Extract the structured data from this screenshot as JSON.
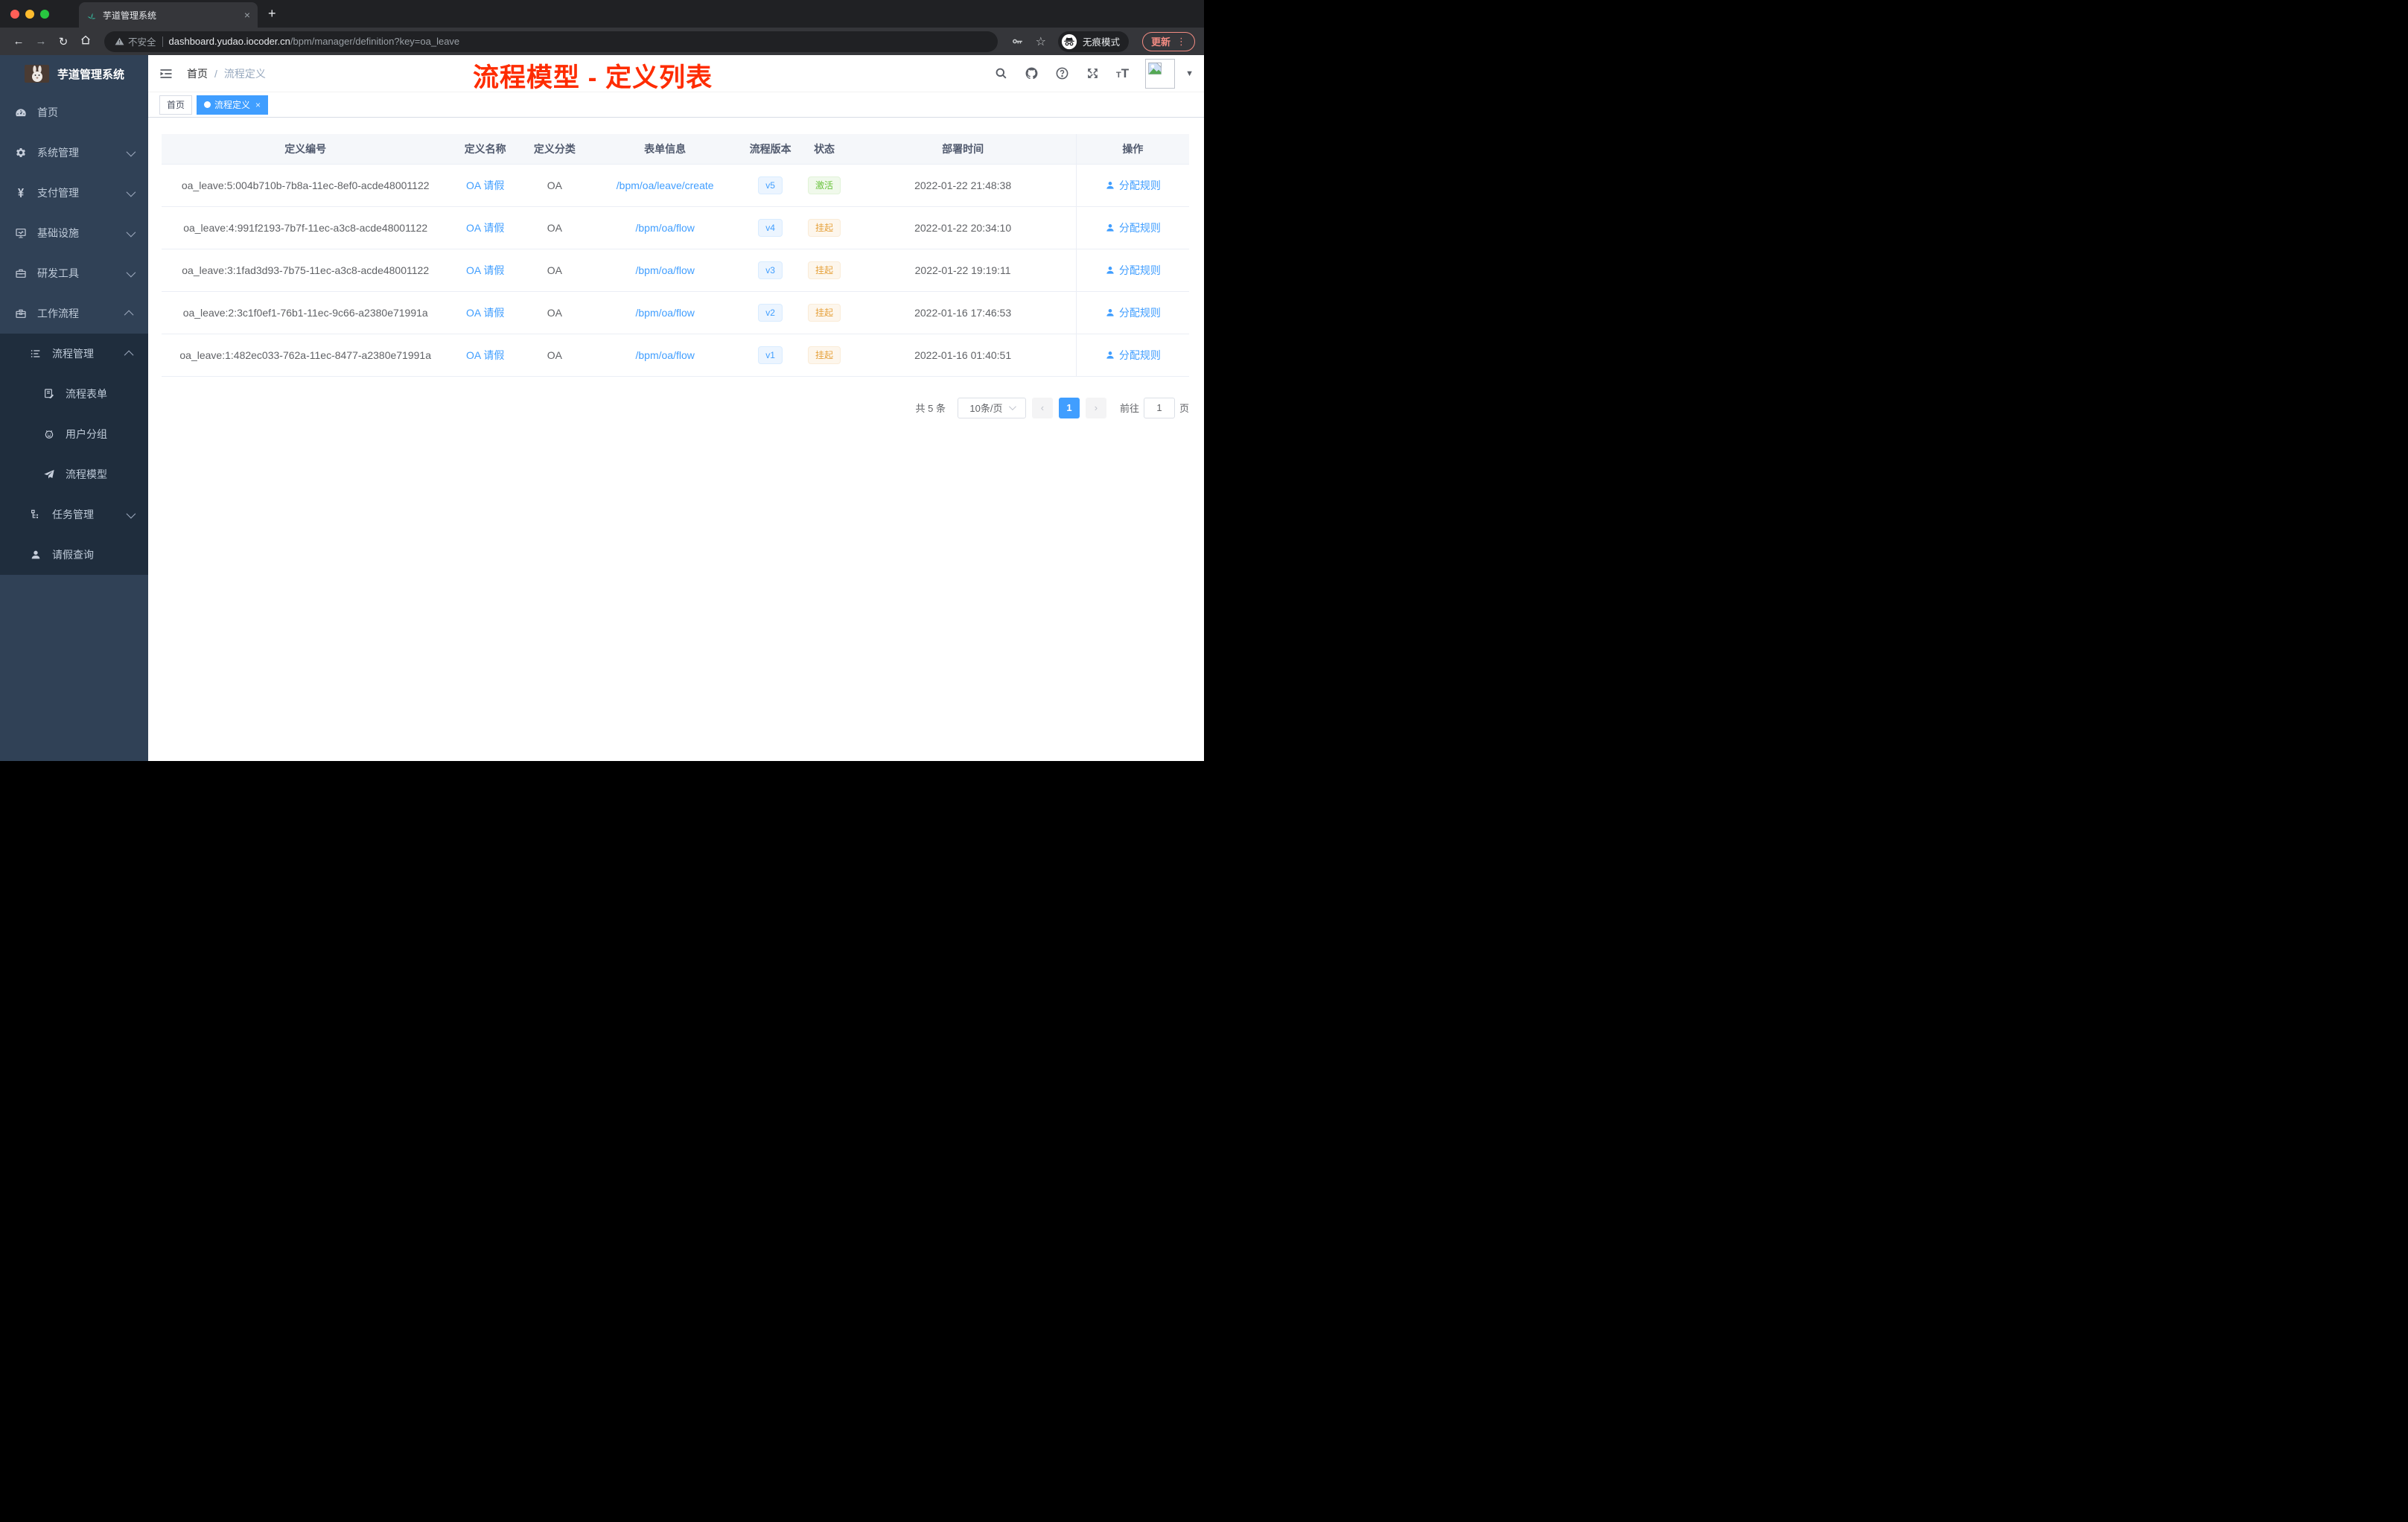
{
  "browser": {
    "tab": {
      "title": "芋道管理系统",
      "close": "×",
      "new_tab": "+"
    },
    "nav": {
      "back": "←",
      "forward": "→",
      "reload": "↻"
    },
    "url": {
      "security_label": "不安全",
      "host": "dashboard.yudao.iocoder.cn",
      "path": "/bpm/manager/definition?key=oa_leave"
    },
    "incognito_label": "无痕模式",
    "update_label": "更新"
  },
  "sidebar": {
    "title": "芋道管理系统",
    "items": [
      {
        "id": "home",
        "label": "首页",
        "icon": "gauge-icon",
        "level": 1,
        "arrow": null,
        "nested": false
      },
      {
        "id": "system",
        "label": "系统管理",
        "icon": "gear-icon",
        "level": 1,
        "arrow": "down",
        "nested": false
      },
      {
        "id": "payment",
        "label": "支付管理",
        "icon": "yen-icon",
        "level": 1,
        "arrow": "down",
        "nested": false
      },
      {
        "id": "infra",
        "label": "基础设施",
        "icon": "monitor-icon",
        "level": 1,
        "arrow": "down",
        "nested": false
      },
      {
        "id": "devtools",
        "label": "研发工具",
        "icon": "toolbox-icon",
        "level": 1,
        "arrow": "down",
        "nested": false
      },
      {
        "id": "workflow",
        "label": "工作流程",
        "icon": "briefcase-icon",
        "level": 1,
        "arrow": "up",
        "nested": false
      },
      {
        "id": "process-mgmt",
        "label": "流程管理",
        "icon": "list-icon",
        "level": 2,
        "arrow": "up",
        "nested": true
      },
      {
        "id": "process-form",
        "label": "流程表单",
        "icon": "form-icon",
        "level": 3,
        "arrow": null,
        "nested": true
      },
      {
        "id": "user-group",
        "label": "用户分组",
        "icon": "robot-icon",
        "level": 3,
        "arrow": null,
        "nested": true
      },
      {
        "id": "process-model",
        "label": "流程模型",
        "icon": "paper-plane-icon",
        "level": 3,
        "arrow": null,
        "nested": true
      },
      {
        "id": "task-mgmt",
        "label": "任务管理",
        "icon": "tree-icon",
        "level": 2,
        "arrow": "down",
        "nested": true
      },
      {
        "id": "leave-query",
        "label": "请假查询",
        "icon": "person-icon",
        "level": 2,
        "arrow": null,
        "nested": true
      }
    ]
  },
  "header": {
    "breadcrumb": {
      "home": "首页",
      "separator": "/",
      "current": "流程定义"
    },
    "annotation": "流程模型 - 定义列表"
  },
  "tags": {
    "home": "首页",
    "active": "流程定义",
    "close": "×"
  },
  "table": {
    "columns": [
      "定义编号",
      "定义名称",
      "定义分类",
      "表单信息",
      "流程版本",
      "状态",
      "部署时间",
      "操作"
    ],
    "action_label": "分配规则",
    "rows": [
      {
        "id": "oa_leave:5:004b710b-7b8a-11ec-8ef0-acde48001122",
        "name": "OA 请假",
        "category": "OA",
        "form": "/bpm/oa/leave/create",
        "version": "v5",
        "status": {
          "label": "激活",
          "type": "success"
        },
        "deploy_time": "2022-01-22 21:48:38"
      },
      {
        "id": "oa_leave:4:991f2193-7b7f-11ec-a3c8-acde48001122",
        "name": "OA 请假",
        "category": "OA",
        "form": "/bpm/oa/flow",
        "version": "v4",
        "status": {
          "label": "挂起",
          "type": "warning"
        },
        "deploy_time": "2022-01-22 20:34:10"
      },
      {
        "id": "oa_leave:3:1fad3d93-7b75-11ec-a3c8-acde48001122",
        "name": "OA 请假",
        "category": "OA",
        "form": "/bpm/oa/flow",
        "version": "v3",
        "status": {
          "label": "挂起",
          "type": "warning"
        },
        "deploy_time": "2022-01-22 19:19:11"
      },
      {
        "id": "oa_leave:2:3c1f0ef1-76b1-11ec-9c66-a2380e71991a",
        "name": "OA 请假",
        "category": "OA",
        "form": "/bpm/oa/flow",
        "version": "v2",
        "status": {
          "label": "挂起",
          "type": "warning"
        },
        "deploy_time": "2022-01-16 17:46:53"
      },
      {
        "id": "oa_leave:1:482ec033-762a-11ec-8477-a2380e71991a",
        "name": "OA 请假",
        "category": "OA",
        "form": "/bpm/oa/flow",
        "version": "v1",
        "status": {
          "label": "挂起",
          "type": "warning"
        },
        "deploy_time": "2022-01-16 01:40:51"
      }
    ]
  },
  "pagination": {
    "total_text": "共 5 条",
    "page_size": "10条/页",
    "current_page": "1",
    "goto_label": "前往",
    "goto_value": "1",
    "page_suffix": "页"
  },
  "colors": {
    "accent": "#409eff",
    "sidebar_bg": "#304156",
    "sidebar_nested_bg": "#1f2d3d",
    "annotation_red": "#fe2c00",
    "success_text": "#67c23a",
    "warning_text": "#e6a23c",
    "update_pill": "#f28b82"
  }
}
